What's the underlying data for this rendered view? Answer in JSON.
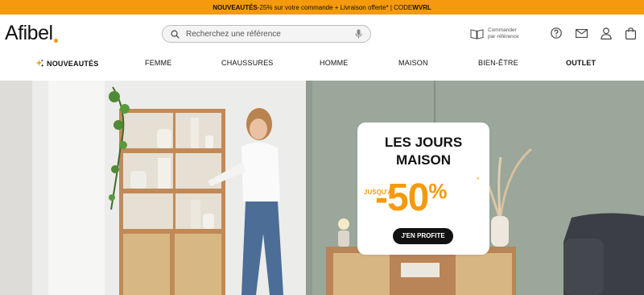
{
  "promo_bar": {
    "part1": "NOUVEAUTÉS",
    "part2": " -25% sur votre commande + Livraison offerte",
    "part3": "* | CODE ",
    "code": "WVRL"
  },
  "header": {
    "logo": "Afibel",
    "search_placeholder": "Recherchez une référence",
    "commander_label": "Commander par référence"
  },
  "nav": {
    "items": [
      "NOUVEAUTÉS",
      "FEMME",
      "CHAUSSURES",
      "HOMME",
      "MAISON",
      "BIEN-ÊTRE",
      "OUTLET"
    ]
  },
  "hero": {
    "title": "LES JOURS MAISON",
    "upto": "JUSQU'À",
    "discount": "-50",
    "percent": "%",
    "asterisk": "*",
    "cta": "J'EN PROFITE"
  },
  "colors": {
    "accent": "#f59a0c",
    "dark": "#111111"
  }
}
